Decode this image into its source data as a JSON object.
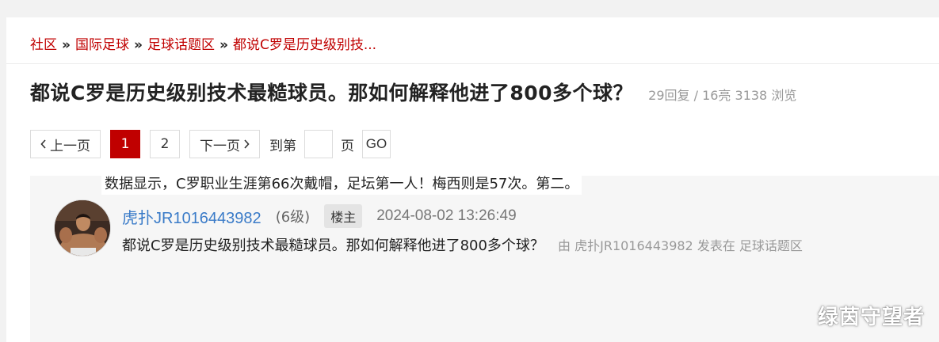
{
  "breadcrumb": {
    "items": [
      "社区",
      "国际足球",
      "足球话题区",
      "都说C罗是历史级别技..."
    ],
    "separator": "»"
  },
  "thread": {
    "title": "都说C罗是历史级别技术最糙球员。那如何解释他进了800多个球？",
    "stats": "29回复 / 16亮 3138 浏览"
  },
  "pager": {
    "prev": "上一页",
    "pages": [
      "1",
      "2"
    ],
    "current": "1",
    "next": "下一页",
    "goto_label": "到第",
    "page_label": "页",
    "go": "GO"
  },
  "post": {
    "author": "虎扑JR1016443982",
    "level": "(6级)",
    "badge": "楼主",
    "time": "2024-08-02 13:26:49",
    "subtitle": "都说C罗是历史级别技术最糙球员。那如何解释他进了800多个球？",
    "by_line": "由 虎扑JR1016443982 发表在 足球话题区",
    "content": "数据显示，C罗职业生涯第66次戴帽，足坛第一人！梅西则是57次。第二。"
  },
  "watermark": "绿茵守望者",
  "colors": {
    "accent": "#c00000",
    "author": "#3a7bc8"
  },
  "icons": {
    "prev": "chevron-left-icon",
    "next": "chevron-right-icon"
  }
}
